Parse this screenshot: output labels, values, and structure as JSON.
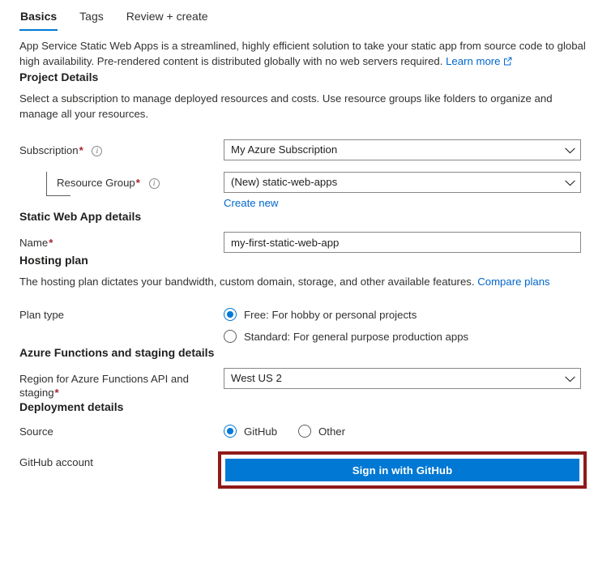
{
  "tabs": [
    {
      "label": "Basics",
      "active": true
    },
    {
      "label": "Tags",
      "active": false
    },
    {
      "label": "Review + create",
      "active": false
    }
  ],
  "intro": {
    "text": "App Service Static Web Apps is a streamlined, highly efficient solution to take your static app from source code to global high availability. Pre-rendered content is distributed globally with no web servers required.",
    "learn_more_label": "Learn more",
    "learn_more_icon": "external-link-icon"
  },
  "project_details": {
    "heading": "Project Details",
    "description": "Select a subscription to manage deployed resources and costs. Use resource groups like folders to organize and manage all your resources.",
    "subscription": {
      "label": "Subscription",
      "required": "*",
      "info_icon": "info-icon",
      "value": "My Azure Subscription",
      "chevron_icon": "chevron-down-icon"
    },
    "resource_group": {
      "label": "Resource Group",
      "required": "*",
      "info_icon": "info-icon",
      "value": "(New) static-web-apps",
      "chevron_icon": "chevron-down-icon",
      "create_new_label": "Create new"
    }
  },
  "static_web_app_details": {
    "heading": "Static Web App details",
    "name": {
      "label": "Name",
      "required": "*",
      "value": "my-first-static-web-app",
      "placeholder": ""
    }
  },
  "hosting_plan": {
    "heading": "Hosting plan",
    "description": "The hosting plan dictates your bandwidth, custom domain, storage, and other available features.",
    "compare_plans_label": "Compare plans",
    "plan_type": {
      "label": "Plan type",
      "options": [
        {
          "label": "Free: For hobby or personal projects",
          "selected": true
        },
        {
          "label": "Standard: For general purpose production apps",
          "selected": false
        }
      ]
    }
  },
  "azure_functions": {
    "heading": "Azure Functions and staging details",
    "region": {
      "label": "Region for Azure Functions API and staging",
      "required": "*",
      "value": "West US 2",
      "chevron_icon": "chevron-down-icon"
    }
  },
  "deployment_details": {
    "heading": "Deployment details",
    "source": {
      "label": "Source",
      "options": [
        {
          "label": "GitHub",
          "selected": true
        },
        {
          "label": "Other",
          "selected": false
        }
      ]
    },
    "github_account": {
      "label": "GitHub account",
      "sign_in_label": "Sign in with GitHub"
    }
  },
  "colors": {
    "accent": "#0078d4",
    "link": "#0066cc",
    "required_asterisk": "#a4262c",
    "annotation_border": "#8f1a1a",
    "text": "#201f1e"
  }
}
